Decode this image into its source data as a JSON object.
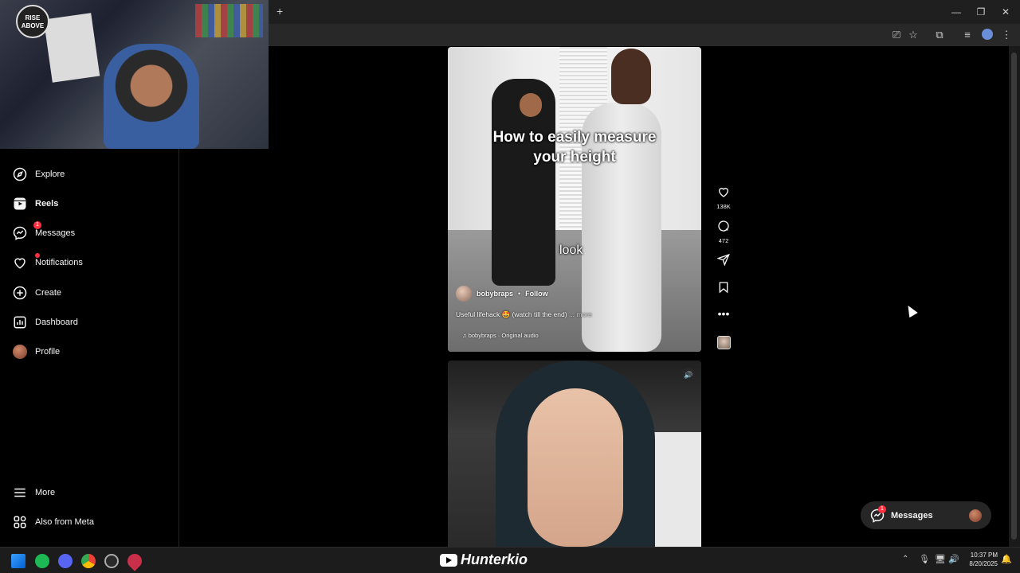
{
  "browser": {
    "new_tab_label": "+",
    "window_controls": [
      "minimize-icon",
      "restore-icon",
      "close-icon"
    ],
    "toolbar_icons": [
      "install-app-icon",
      "bookmark-star-icon",
      "extensions-icon",
      "media-control-icon",
      "profile-avatar",
      "menu-kebab-icon"
    ]
  },
  "webcam": {
    "logo_line1": "RISE",
    "logo_line2": "ABOVE"
  },
  "sidebar": {
    "items": [
      {
        "label": "Explore",
        "icon": "compass-icon"
      },
      {
        "label": "Reels",
        "icon": "reels-icon"
      },
      {
        "label": "Messages",
        "icon": "messenger-icon",
        "badge": "1"
      },
      {
        "label": "Notifications",
        "icon": "heart-icon"
      },
      {
        "label": "Create",
        "icon": "plus-square-icon"
      },
      {
        "label": "Dashboard",
        "icon": "dashboard-icon"
      },
      {
        "label": "Profile",
        "icon": "avatar"
      }
    ],
    "bottom": [
      {
        "label": "More",
        "icon": "hamburger-icon"
      },
      {
        "label": "Also from Meta",
        "icon": "meta-apps-icon"
      }
    ]
  },
  "reel": {
    "title_line1": "How to easily measure",
    "title_line2": "your height",
    "subtitle": "look",
    "username": "bobybraps",
    "separator": "•",
    "follow": "Follow",
    "description": "Useful lifehack 🤩 (watch till the end)",
    "more": "... more",
    "audio": "bobybraps · Original audio",
    "likes": "138K",
    "comments": "472"
  },
  "messages_pill": {
    "label": "Messages",
    "badge": "1"
  },
  "taskbar": {
    "overlay_brand": "Hunterkio",
    "time": "10:37 PM",
    "date": "8/20/2025"
  },
  "colors": {
    "badge_red": "#ff3040",
    "bg": "#000000",
    "panel": "#262626"
  }
}
